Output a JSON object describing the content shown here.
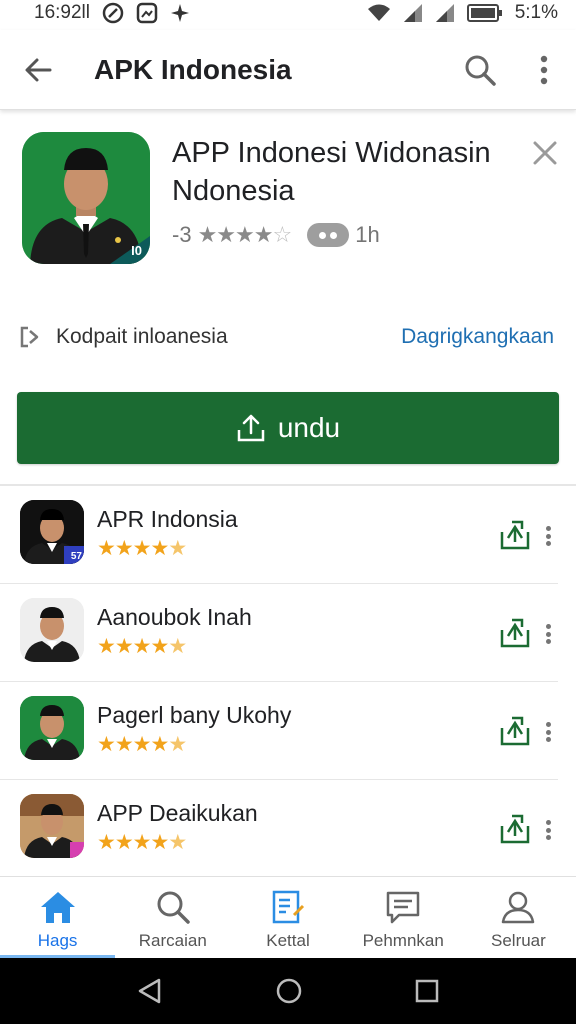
{
  "status_bar": {
    "time": "16:92ll",
    "battery": "5:1%"
  },
  "app_bar": {
    "title": "APK Indonesia"
  },
  "hero": {
    "title": "APP Indonesi Widonasin Ndonesia",
    "rating_prefix": "-3",
    "rating_stars": 3.5,
    "meta_time": "1h",
    "icon_badge": "I0"
  },
  "developer": {
    "name": "Kodpait inloanesia",
    "link": "Dagrigkangkaan"
  },
  "install": {
    "label": "undu"
  },
  "apps": [
    {
      "name": "APR Indonsia",
      "rating": 4.5,
      "badge": "57",
      "badge_color": "#2f3fbf",
      "bg": "#f1f1f1"
    },
    {
      "name": "Aanoubok Inah",
      "rating": 4.5,
      "badge": "",
      "badge_color": "",
      "bg": "#eeeeee"
    },
    {
      "name": "Pagerl bany Ukohy",
      "rating": 4.5,
      "badge": "",
      "badge_color": "",
      "bg": "#1e8a3e"
    },
    {
      "name": "APP Deaikukan",
      "rating": 4.5,
      "badge": "",
      "badge_color": "#d63fb0",
      "bg": "#c59a6a"
    }
  ],
  "bottom_nav": [
    {
      "label": "Hags",
      "icon": "home-icon",
      "active": true
    },
    {
      "label": "Rarcaian",
      "icon": "search-icon",
      "active": false
    },
    {
      "label": "Kettal",
      "icon": "notes-icon",
      "active": false
    },
    {
      "label": "Pehmnkan",
      "icon": "chat-icon",
      "active": false
    },
    {
      "label": "Selruar",
      "icon": "person-icon",
      "active": false
    }
  ],
  "colors": {
    "accent": "#1b6b32",
    "link": "#1f6fb2",
    "star": "#f2a31b",
    "nav_active": "#1a73e8"
  }
}
